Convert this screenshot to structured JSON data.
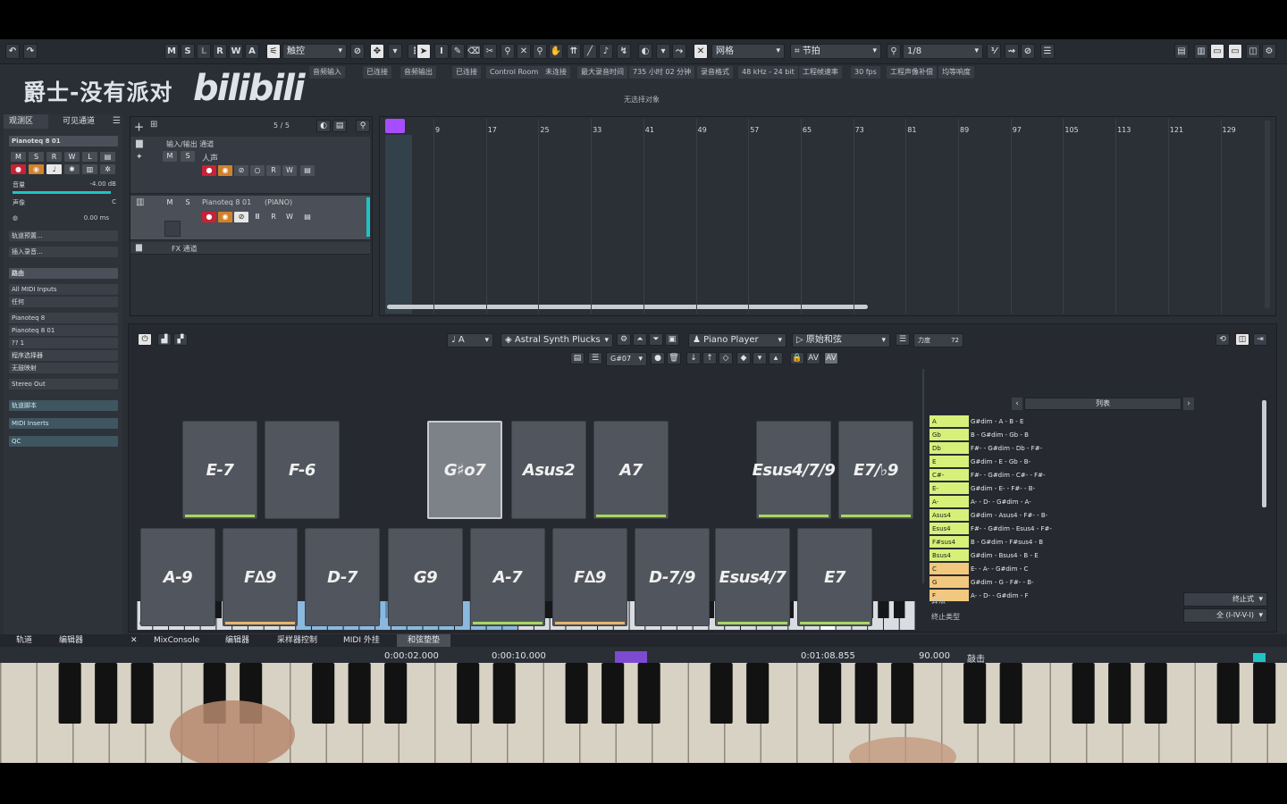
{
  "topbar": {
    "msrwa": [
      "M",
      "S",
      "L",
      "R",
      "W",
      "A"
    ],
    "automation_mode": "触控",
    "grid_type": "网格",
    "snap_mode": "节拍",
    "quantize": "1/8"
  },
  "statusbar": [
    {
      "label": "音频输入",
      "value": "已连接"
    },
    {
      "label": "音频输出",
      "value": "已连接"
    },
    {
      "label": "Control Room",
      "value": "未连接"
    },
    {
      "label": "最大录音时间",
      "value": "735 小时 02 分钟"
    },
    {
      "label": "录音格式",
      "value": "48 kHz - 24 bit"
    },
    {
      "label": "工程帧速率",
      "value": "30 fps"
    },
    {
      "label": "工程声像补偿",
      "value": "均等响度"
    }
  ],
  "no_selection": "无选择对象",
  "logo": {
    "channel_name": "爵士-没有派对",
    "site": "bilibili"
  },
  "inspector": {
    "tabs": [
      "观测区",
      "可见通道"
    ],
    "track_name": "Pianoteq 8 01",
    "buttons": [
      "M",
      "S",
      "R",
      "W",
      "L"
    ],
    "volume_label": "音量",
    "volume_value": "-4.00 dB",
    "pan_label": "声像",
    "pan_value": "C",
    "delay_value": "0.00 ms",
    "track_preset": "轨道预置...",
    "insert_audio": "插入录音...",
    "routing_header": "路由",
    "midi_input": "All MIDI Inputs",
    "channel_any": "任何",
    "instrument": "Pianoteq 8",
    "instrument_out": "Pianoteq 8 01",
    "channel_num": "?? 1",
    "program_selector": "程序选择器",
    "no_mapping": "无鼓映射",
    "stereo_out": "Stereo Out",
    "sections": [
      "轨道脚本",
      "MIDI Inserts",
      "QC"
    ]
  },
  "tracks": {
    "counter": "5 / 5",
    "folder": "输入/输出 通道",
    "vocal": "人声",
    "piano": "Pianoteq 8 01",
    "piano_tag": "(PIANO)",
    "fx": "FX 通道"
  },
  "ruler": [
    "9",
    "17",
    "25",
    "33",
    "41",
    "49",
    "57",
    "65",
    "73",
    "81",
    "89",
    "97",
    "105",
    "113",
    "121",
    "129"
  ],
  "chord_pads": {
    "key": "A",
    "synth": "Astral Synth Plucks",
    "player": "Piano Player",
    "mode": "原始和弦",
    "velocity_label": "力度",
    "velocity_value": "72",
    "chord_selected": "G#07",
    "row1": [
      {
        "name": "E-7",
        "bar": "#a9d660"
      },
      {
        "name": "F-6",
        "bar": ""
      },
      {
        "name": "G♯o7",
        "bar": "",
        "selected": true
      },
      {
        "name": "Asus2",
        "bar": ""
      },
      {
        "name": "A7",
        "bar": "#a9d660"
      },
      {
        "name": "Esus4/7/9",
        "bar": "#a9d660"
      },
      {
        "name": "E7/♭9",
        "bar": "#a9d660"
      }
    ],
    "row2": [
      {
        "name": "A-9",
        "bar": ""
      },
      {
        "name": "F∆9",
        "bar": "#e8b46a"
      },
      {
        "name": "D-7",
        "bar": ""
      },
      {
        "name": "G9",
        "bar": ""
      },
      {
        "name": "A-7",
        "bar": "#a9d660"
      },
      {
        "name": "F∆9",
        "bar": "#e8b46a"
      },
      {
        "name": "D-7/9",
        "bar": ""
      },
      {
        "name": "Esus4/7",
        "bar": "#a9d660"
      },
      {
        "name": "E7",
        "bar": "#a9d660"
      }
    ],
    "octaves": [
      "C0",
      "C1",
      "C2",
      "C3",
      "C4",
      "C5",
      "C6"
    ],
    "list_header": "列表",
    "list": [
      {
        "k": "A",
        "v": "G#dim - A - B - E",
        "c": "#d7f07a"
      },
      {
        "k": "Gb",
        "v": "B - G#dim - Gb - B",
        "c": "#d7f07a"
      },
      {
        "k": "Db",
        "v": "F#- - G#dim - Db - F#-",
        "c": "#d7f07a"
      },
      {
        "k": "E",
        "v": "G#dim - E - Gb - B-",
        "c": "#d7f07a"
      },
      {
        "k": "C#-",
        "v": "F#- - G#dim - C#- - F#-",
        "c": "#d7f07a"
      },
      {
        "k": "E-",
        "v": "G#dim - E- - F#- - B-",
        "c": "#d7f07a"
      },
      {
        "k": "A-",
        "v": "A- - D- - G#dim - A-",
        "c": "#d7f07a"
      },
      {
        "k": "Asus4",
        "v": "G#dim - Asus4 - F#- - B-",
        "c": "#d7f07a"
      },
      {
        "k": "Esus4",
        "v": "F#- - G#dim - Esus4 - F#-",
        "c": "#d7f07a"
      },
      {
        "k": "F#sus4",
        "v": "B - G#dim - F#sus4 - B",
        "c": "#d7f07a"
      },
      {
        "k": "Bsus4",
        "v": "G#dim - Bsus4 - B - E",
        "c": "#d7f07a"
      },
      {
        "k": "C",
        "v": "E- - A- - G#dim - C",
        "c": "#f2c77e"
      },
      {
        "k": "G",
        "v": "G#dim - G - F#- - B-",
        "c": "#f2c77e"
      },
      {
        "k": "F",
        "v": "A- - D- - G#dim - F",
        "c": "#f2c77e"
      }
    ],
    "algo_label": "算法",
    "algo_value": "终止式",
    "end_type_label": "终止类型",
    "end_type_value": "全 (I-IV-V-I)"
  },
  "bottom_tabs": [
    "轨道",
    "编辑器",
    "MixConsole",
    "编辑器",
    "采样器控制",
    "MIDI 外挂",
    "和弦垫垫"
  ],
  "transport": {
    "left_locator": "0:00:02.000",
    "right_locator": "0:00:10.000",
    "position": "0:01:08.855",
    "tempo": "90.000",
    "sig": "敲击"
  },
  "colors": {
    "green": "#a9d660",
    "orange": "#e8b46a",
    "record": "#c72236",
    "cyan": "#1fc4c4",
    "purple": "#a64dff"
  }
}
